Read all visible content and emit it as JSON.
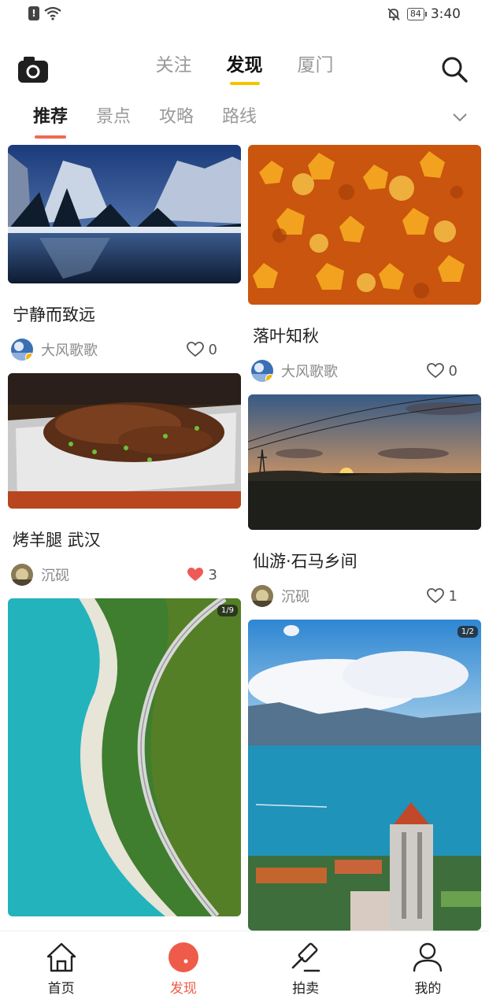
{
  "status_bar": {
    "time": "3:40",
    "battery": "84"
  },
  "header": {
    "tabs": [
      {
        "label": "关注",
        "active": false
      },
      {
        "label": "发现",
        "active": true
      },
      {
        "label": "厦门",
        "active": false
      }
    ]
  },
  "categories": [
    {
      "label": "推荐",
      "active": true
    },
    {
      "label": "景点",
      "active": false
    },
    {
      "label": "攻略",
      "active": false
    },
    {
      "label": "路线",
      "active": false
    }
  ],
  "feed": {
    "left": [
      {
        "title": "宁静而致远",
        "author": "大风歌歌",
        "likes": "0",
        "liked": false,
        "image": "snowy-mountain-lake"
      },
      {
        "title": "烤羊腿 武汉",
        "author": "沉砚",
        "likes": "3",
        "liked": true,
        "image": "roast-lamb"
      },
      {
        "badge": "1/9",
        "image": "coastal-road-aerial"
      }
    ],
    "right": [
      {
        "title": "落叶知秋",
        "author": "大风歌歌",
        "likes": "0",
        "liked": false,
        "image": "autumn-maple-leaves"
      },
      {
        "title": "仙游·石马乡间",
        "author": "沉砚",
        "likes": "1",
        "liked": false,
        "image": "sunset-power-lines"
      },
      {
        "badge": "1/2",
        "image": "xiamen-university-sea"
      }
    ]
  },
  "bottom_nav": [
    {
      "label": "首页",
      "icon": "home-icon",
      "active": false
    },
    {
      "label": "发现",
      "icon": "discover-icon",
      "active": true
    },
    {
      "label": "拍卖",
      "icon": "gavel-icon",
      "active": false
    },
    {
      "label": "我的",
      "icon": "person-icon",
      "active": false
    }
  ],
  "colors": {
    "accent": "#ee5b49",
    "tab_underline": "#f7c300",
    "category_underline": "#f06a53",
    "liked_heart": "#ee5b56"
  }
}
